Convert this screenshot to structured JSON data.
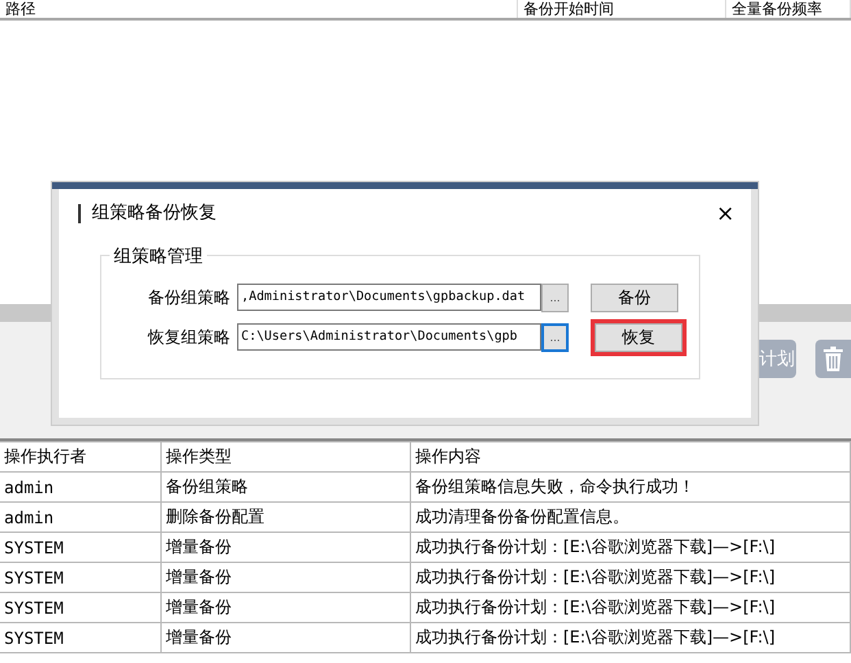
{
  "top_table": {
    "columns": [
      "路径",
      "备份开始时间",
      "全量备份频率"
    ]
  },
  "toolbar": {
    "plan_button": "计划"
  },
  "dialog": {
    "title": "组策略备份恢复",
    "close": "×",
    "group": {
      "legend": "组策略管理",
      "rows": [
        {
          "label": "备份组策略",
          "value": ",Administrator\\Documents\\gpbackup.dat",
          "browse": "...",
          "browse_focused": false,
          "action": "备份",
          "action_highlighted": false
        },
        {
          "label": "恢复组策略",
          "value": "C:\\Users\\Administrator\\Documents\\gpb",
          "browse": "...",
          "browse_focused": true,
          "action": "恢复",
          "action_highlighted": true
        }
      ]
    }
  },
  "log_table": {
    "columns": [
      "操作执行者",
      "操作类型",
      "操作内容"
    ],
    "rows": [
      [
        "admin",
        "备份组策略",
        "备份组策略信息失败，命令执行成功！"
      ],
      [
        "admin",
        "删除备份配置",
        "成功清理备份备份配置信息。"
      ],
      [
        "SYSTEM",
        "增量备份",
        "成功执行备份计划：[E:\\谷歌浏览器下载]—>[F:\\]"
      ],
      [
        "SYSTEM",
        "增量备份",
        "成功执行备份计划：[E:\\谷歌浏览器下载]—>[F:\\]"
      ],
      [
        "SYSTEM",
        "增量备份",
        "成功执行备份计划：[E:\\谷歌浏览器下载]—>[F:\\]"
      ],
      [
        "SYSTEM",
        "增量备份",
        "成功执行备份计划：[E:\\谷歌浏览器下载]—>[F:\\]"
      ]
    ]
  }
}
